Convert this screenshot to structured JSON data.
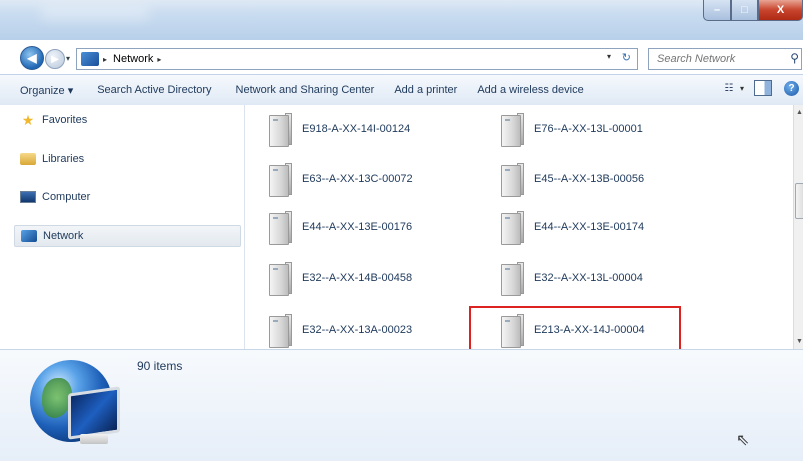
{
  "window": {
    "controls": {
      "minimize": "–",
      "maximize": "□",
      "close": "X"
    }
  },
  "address_bar": {
    "location": "Network",
    "separator": "▸",
    "drop": "▾",
    "refresh": "↻"
  },
  "search": {
    "placeholder": "Search Network",
    "icon": "search-icon"
  },
  "toolbar": {
    "items": [
      "Organize ▾",
      "Search Active Directory",
      "Network and Sharing Center",
      "Add a printer",
      "Add a wireless device"
    ],
    "views_drop": "▾",
    "help": "?"
  },
  "sidebar": {
    "items": [
      {
        "label": "Favorites",
        "icon": "star-icon"
      },
      {
        "label": "Libraries",
        "icon": "library-icon"
      },
      {
        "label": "Computer",
        "icon": "computer-icon"
      },
      {
        "label": "Network",
        "icon": "network-icon",
        "selected": true
      }
    ]
  },
  "content": {
    "items": [
      {
        "label": "E918-A-XX-14I-00124"
      },
      {
        "label": "E76--A-XX-13L-00001"
      },
      {
        "label": "E63--A-XX-13C-00072"
      },
      {
        "label": "E45--A-XX-13B-00056"
      },
      {
        "label": "E44--A-XX-13E-00176"
      },
      {
        "label": "E44--A-XX-13E-00174"
      },
      {
        "label": "E32--A-XX-14B-00458"
      },
      {
        "label": "E32--A-XX-13L-00004"
      },
      {
        "label": "E32--A-XX-13A-00023"
      },
      {
        "label": "E213-A-XX-14J-00004",
        "highlighted": true
      }
    ]
  },
  "details": {
    "count": "90 items"
  },
  "colors": {
    "highlight": "#dd2222",
    "text": "#1e395b"
  }
}
